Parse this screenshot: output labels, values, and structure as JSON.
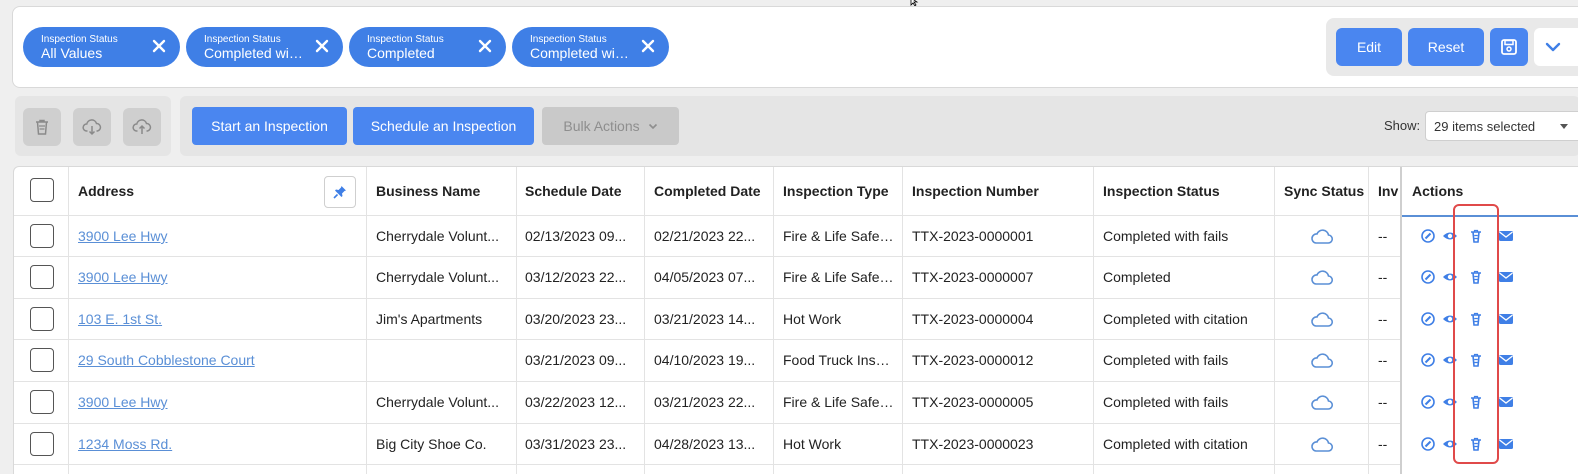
{
  "filters": [
    {
      "label": "Inspection Status",
      "value": "All Values"
    },
    {
      "label": "Inspection Status",
      "value": "Completed wit..."
    },
    {
      "label": "Inspection Status",
      "value": "Completed"
    },
    {
      "label": "Inspection Status",
      "value": "Completed wit..."
    }
  ],
  "filter_actions": {
    "edit": "Edit",
    "reset": "Reset"
  },
  "toolbar": {
    "start": "Start an Inspection",
    "schedule": "Schedule an Inspection",
    "bulk": "Bulk Actions",
    "show_label": "Show:",
    "show_value": "29 items selected"
  },
  "columns": [
    "Address",
    "Business Name",
    "Schedule Date",
    "Completed Date",
    "Inspection Type",
    "Inspection Number",
    "Inspection Status",
    "Sync Status",
    "Inv",
    "Actions"
  ],
  "rows": [
    {
      "address": "3900 Lee Hwy",
      "business": "Cherrydale Volunt...",
      "schedule": "02/13/2023 09...",
      "completed": "02/21/2023 22...",
      "type": "Fire & Life Safet...",
      "number": "TTX-2023-0000001",
      "status": "Completed with fails",
      "inv": "--"
    },
    {
      "address": "3900 Lee Hwy",
      "business": "Cherrydale Volunt...",
      "schedule": "03/12/2023 22...",
      "completed": "04/05/2023 07...",
      "type": "Fire & Life Safet...",
      "number": "TTX-2023-0000007",
      "status": "Completed",
      "inv": "--"
    },
    {
      "address": "103 E. 1st St.",
      "business": "Jim's Apartments",
      "schedule": "03/20/2023 23...",
      "completed": "03/21/2023 14...",
      "type": "Hot Work",
      "number": "TTX-2023-0000004",
      "status": "Completed with citation",
      "inv": "--"
    },
    {
      "address": "29 South Cobblestone Court",
      "business": "",
      "schedule": "03/21/2023 09...",
      "completed": "04/10/2023 19...",
      "type": "Food Truck Insp...",
      "number": "TTX-2023-0000012",
      "status": "Completed with fails",
      "inv": "--"
    },
    {
      "address": "3900 Lee Hwy",
      "business": "Cherrydale Volunt...",
      "schedule": "03/22/2023 12...",
      "completed": "03/21/2023 22...",
      "type": "Fire & Life Safet...",
      "number": "TTX-2023-0000005",
      "status": "Completed with fails",
      "inv": "--"
    },
    {
      "address": "1234 Moss Rd.",
      "business": "Big City Shoe Co.",
      "schedule": "03/31/2023 23...",
      "completed": "04/28/2023 13...",
      "type": "Hot Work",
      "number": "TTX-2023-0000023",
      "status": "Completed with citation",
      "inv": "--"
    }
  ],
  "icons": {
    "chip_close": "close-icon",
    "save": "save-icon",
    "expand": "chevron-down-icon",
    "delete": "trash-icon",
    "download": "cloud-download-icon",
    "upload": "cloud-upload-icon",
    "pin": "pin-icon",
    "sync": "cloud-icon",
    "actions": [
      "edit-icon",
      "view-icon",
      "trash-icon",
      "email-icon"
    ]
  },
  "colors": {
    "primary": "#4a86f0",
    "chip": "#3f7fe6",
    "link": "#5a8fd6",
    "highlight": "#e04a4a"
  }
}
